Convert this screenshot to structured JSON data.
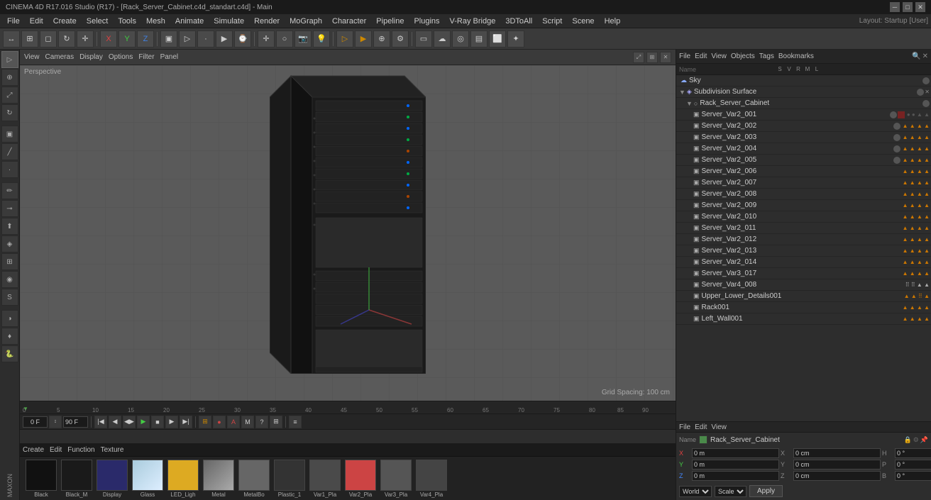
{
  "titleBar": {
    "title": "CINEMA 4D R17.016 Studio (R17) - [Rack_Server_Cabinet.c4d_standart.c4d] - Main",
    "minimize": "─",
    "maximize": "□",
    "close": "✕"
  },
  "menuBar": {
    "items": [
      "File",
      "Edit",
      "Create",
      "Select",
      "Tools",
      "Mesh",
      "Animate",
      "Simulate",
      "Render",
      "MoGraph",
      "Character",
      "Pipeline",
      "Plugins",
      "V-Ray Bridge",
      "3DToAll",
      "Script",
      "Scene",
      "Help"
    ]
  },
  "toolbar": {
    "layout_label": "Layout: Startup [User]"
  },
  "viewport": {
    "label": "Perspective",
    "gridSpacing": "Grid Spacing: 100 cm",
    "menus": [
      "View",
      "Cameras",
      "Display",
      "Options",
      "Filter",
      "Panel"
    ]
  },
  "objectManager": {
    "menus": [
      "File",
      "Edit",
      "View",
      "Objects",
      "Tags",
      "Bookmarks"
    ],
    "objects": [
      {
        "name": "Sky",
        "level": 0,
        "icon": "sky"
      },
      {
        "name": "Subdivision Surface",
        "level": 0,
        "icon": "subdiv",
        "selected": false
      },
      {
        "name": "Rack_Server_Cabinet",
        "level": 1,
        "icon": "null",
        "selected": false
      },
      {
        "name": "Server_Var2_001",
        "level": 2,
        "icon": "mesh"
      },
      {
        "name": "Server_Var2_002",
        "level": 2,
        "icon": "mesh"
      },
      {
        "name": "Server_Var2_003",
        "level": 2,
        "icon": "mesh"
      },
      {
        "name": "Server_Var2_004",
        "level": 2,
        "icon": "mesh"
      },
      {
        "name": "Server_Var2_005",
        "level": 2,
        "icon": "mesh"
      },
      {
        "name": "Server_Var2_006",
        "level": 2,
        "icon": "mesh"
      },
      {
        "name": "Server_Var2_007",
        "level": 2,
        "icon": "mesh"
      },
      {
        "name": "Server_Var2_008",
        "level": 2,
        "icon": "mesh"
      },
      {
        "name": "Server_Var2_009",
        "level": 2,
        "icon": "mesh"
      },
      {
        "name": "Server_Var2_010",
        "level": 2,
        "icon": "mesh"
      },
      {
        "name": "Server_Var2_011",
        "level": 2,
        "icon": "mesh"
      },
      {
        "name": "Server_Var2_012",
        "level": 2,
        "icon": "mesh"
      },
      {
        "name": "Server_Var2_013",
        "level": 2,
        "icon": "mesh"
      },
      {
        "name": "Server_Var2_014",
        "level": 2,
        "icon": "mesh"
      },
      {
        "name": "Server_Var3_017",
        "level": 2,
        "icon": "mesh"
      },
      {
        "name": "Server_Var4_008",
        "level": 2,
        "icon": "mesh"
      },
      {
        "name": "Upper_Lower_Details001",
        "level": 2,
        "icon": "mesh"
      },
      {
        "name": "Rack001",
        "level": 2,
        "icon": "mesh"
      },
      {
        "name": "Left_Wall001",
        "level": 2,
        "icon": "mesh"
      }
    ]
  },
  "attrManager": {
    "menus": [
      "File",
      "Edit",
      "View"
    ],
    "name": "Rack_Server_Cabinet",
    "coords": {
      "X": {
        "pos": "0 m",
        "size": "0 cm"
      },
      "Y": {
        "pos": "0 m",
        "size": "0 cm"
      },
      "Z": {
        "pos": "0 m",
        "size": "0 cm"
      },
      "H": "0 °",
      "P": "0 °",
      "B": "0 °"
    }
  },
  "coordBar": {
    "X_label": "X",
    "Y_label": "Y",
    "Z_label": "Z",
    "X_val": "0 m",
    "Y_val": "0 m",
    "Z_val": "0 m",
    "X_size": "0 cm",
    "Y_size": "0 cm",
    "Z_size": "0 cm",
    "H": "0 °",
    "P": "0 °",
    "B": "0 °",
    "world": "World",
    "scale": "Scale",
    "apply": "Apply"
  },
  "timeline": {
    "frames": [
      0,
      5,
      10,
      15,
      20,
      25,
      30,
      35,
      40,
      45,
      50,
      55,
      60,
      65,
      70,
      75,
      80,
      85,
      90
    ],
    "currentFrame": "0 F",
    "endFrame": "90 F",
    "playBtn": "▶",
    "stopBtn": "■",
    "prevBtn": "◀",
    "nextBtn": "▶|",
    "rewindBtn": "|◀",
    "ffBtn": "▶|"
  },
  "matBar": {
    "menus": [
      "Create",
      "Edit",
      "Function",
      "Texture"
    ],
    "materials": [
      {
        "name": "Black",
        "color": "#111111"
      },
      {
        "name": "Black_M",
        "color": "#1a1a1a"
      },
      {
        "name": "Display",
        "color": "#2a2a6a"
      },
      {
        "name": "Glass",
        "color": "#aaccdd"
      },
      {
        "name": "LED_Ligh",
        "color": "#ddaa22"
      },
      {
        "name": "Metal",
        "color": "#888888"
      },
      {
        "name": "MetalBo",
        "color": "#666666"
      },
      {
        "name": "Plastic_1",
        "color": "#333333"
      },
      {
        "name": "Var1_Pla",
        "color": "#4a4a4a"
      },
      {
        "name": "Var2_Pla",
        "color": "#cc4444"
      },
      {
        "name": "Var3_Pla",
        "color": "#555555"
      },
      {
        "name": "Var4_Pla",
        "color": "#444444"
      }
    ]
  }
}
